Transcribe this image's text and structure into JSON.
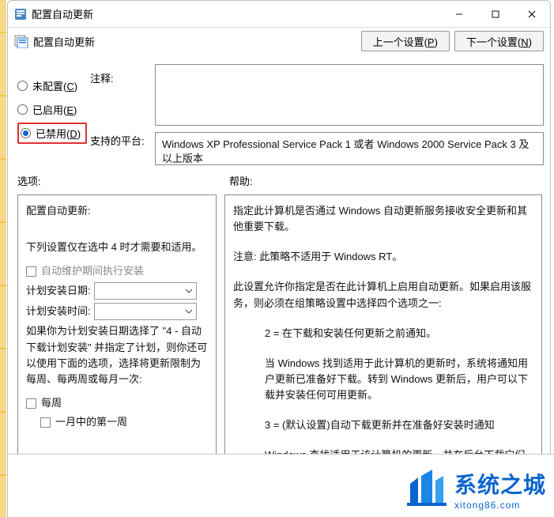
{
  "window": {
    "title": "配置自动更新",
    "policy_title": "配置自动更新",
    "nav_prev": "上一个设置(P)",
    "nav_next": "下一个设置(N)"
  },
  "radios": {
    "not_configured": "未配置(C)",
    "enabled": "已启用(E)",
    "disabled": "已禁用(D)",
    "selected": "disabled"
  },
  "labels": {
    "comment": "注释:",
    "supported_on": "支持的平台:",
    "options": "选项:",
    "help": "帮助:"
  },
  "supported_text": "Windows XP Professional Service Pack 1 或者 Windows 2000 Service Pack 3 及以上版本",
  "options": {
    "header": "配置自动更新:",
    "body_intro": "下列设置仅在选中 4 时才需要和适用。",
    "chk_maintenance": "自动维护期间执行安装",
    "install_day_label": "计划安装日期:",
    "install_time_label": "计划安装时间:",
    "note_line1": "如果你为计划安装日期选择了 \"4 - 自动下载计划安装\" 并指定了计划，则你还可以使用下面的选项，选择将更新限制为每周、每两周或每月一次:",
    "chk_weekly": "每周",
    "chk_first_week": "一月中的第一周"
  },
  "help": {
    "p1": "指定此计算机是否通过 Windows 自动更新服务接收安全更新和其他重要下载。",
    "p2": "注意: 此策略不适用于 Windows RT。",
    "p3": "此设置允许你指定是否在此计算机上启用自动更新。如果启用该服务，则必须在组策略设置中选择四个选项之一:",
    "p4": "2 = 在下载和安装任何更新之前通知。",
    "p5": "当 Windows 找到适用于此计算机的更新时，系统将通知用户更新已准备好下载。转到 Windows 更新后，用户可以下载并安装任何可用更新。",
    "p6": "3 = (默认设置)自动下载更新并在准备好安装时通知",
    "p7": "Windows 查找适用于该计算机的更新，并在后台下载它们(在此过程中，用户不会收到通知或被打扰)。下载完成后，将通知用户更新已准备好进行安装。在转到 Windows 更新后，用户可以安装它们。"
  },
  "watermark": {
    "cn": "系统之城",
    "en": "xitong86.com"
  }
}
